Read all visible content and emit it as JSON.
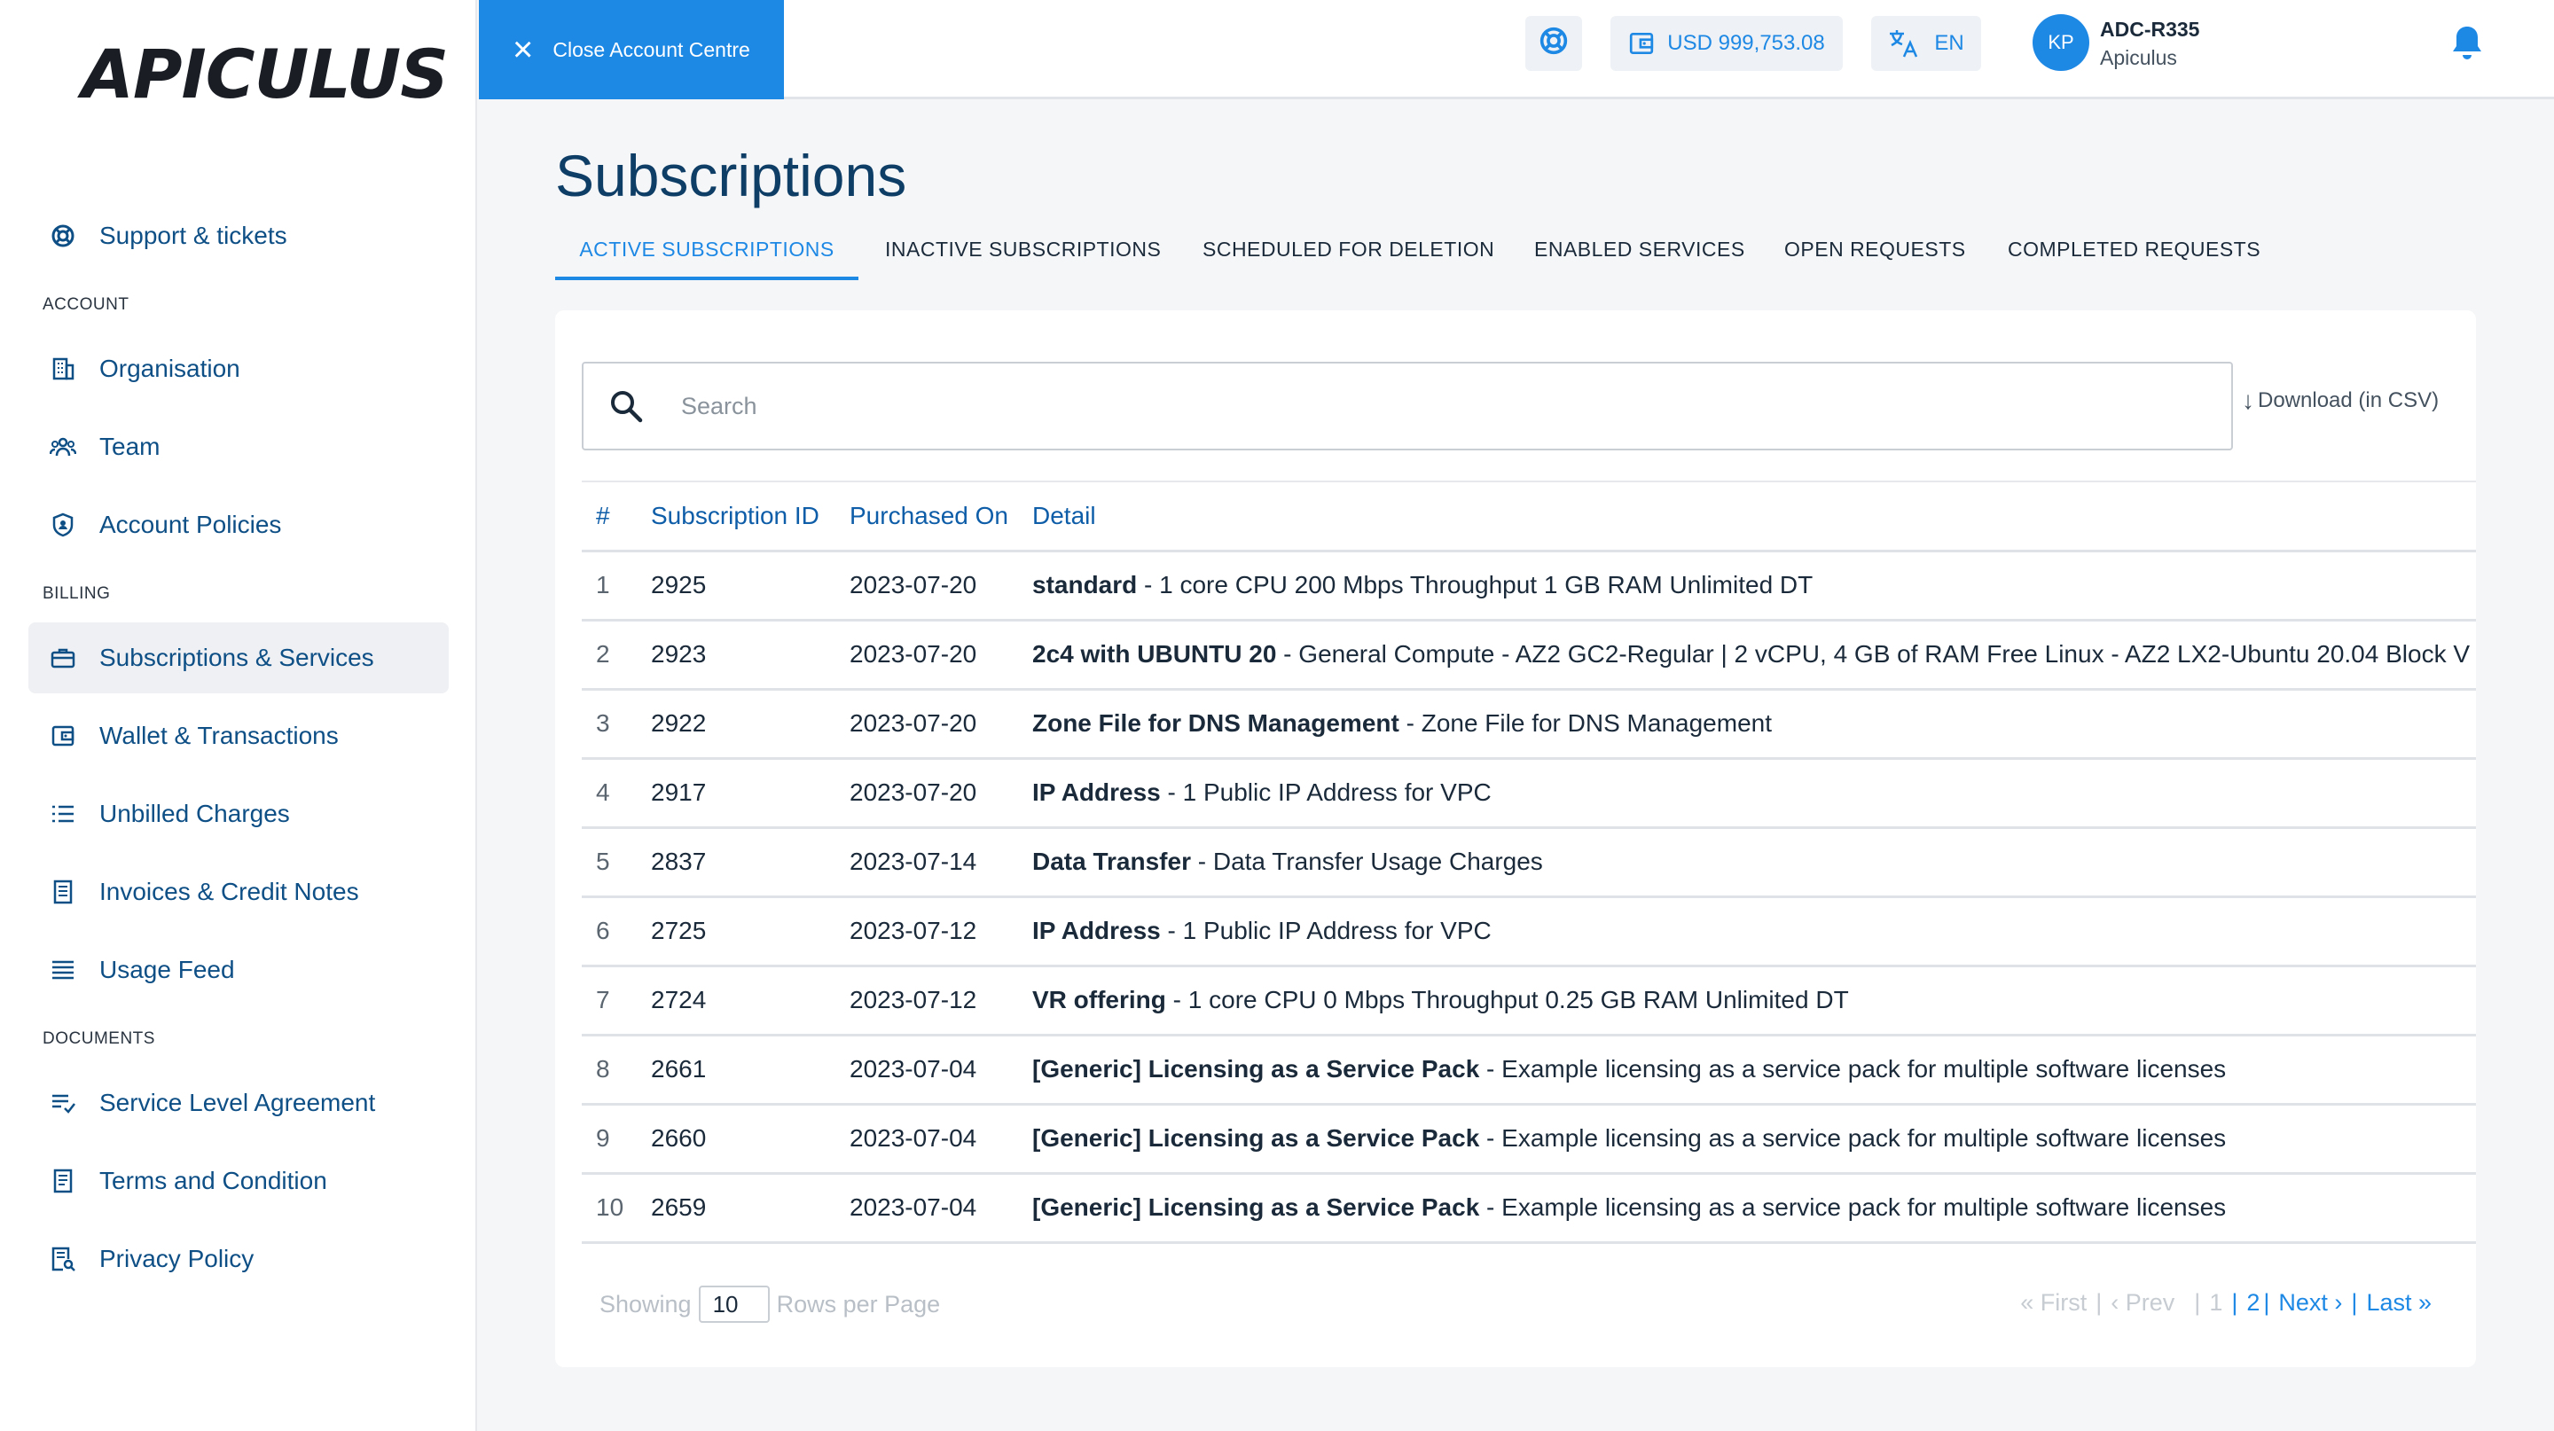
{
  "app": {
    "logo_text": "APICULUS"
  },
  "topbar": {
    "close_label": "Close Account Centre",
    "balance": "USD 999,753.08",
    "language": "EN",
    "avatar_initials": "KP",
    "user_name": "ADC-R335",
    "user_org": "Apiculus"
  },
  "sidebar": {
    "support": "Support & tickets",
    "sections": {
      "account": "ACCOUNT",
      "billing": "BILLING",
      "documents": "DOCUMENTS"
    },
    "items": [
      {
        "label": "Organisation",
        "icon": "building-icon"
      },
      {
        "label": "Team",
        "icon": "team-icon"
      },
      {
        "label": "Account Policies",
        "icon": "shield-icon"
      },
      {
        "label": "Subscriptions & Services",
        "icon": "briefcase-icon",
        "active": true
      },
      {
        "label": "Wallet & Transactions",
        "icon": "wallet-icon"
      },
      {
        "label": "Unbilled Charges",
        "icon": "list-icon"
      },
      {
        "label": "Invoices & Credit Notes",
        "icon": "invoice-icon"
      },
      {
        "label": "Usage Feed",
        "icon": "feed-icon"
      },
      {
        "label": "Service Level Agreement",
        "icon": "sla-icon"
      },
      {
        "label": "Terms and Condition",
        "icon": "document-icon"
      },
      {
        "label": "Privacy Policy",
        "icon": "privacy-icon"
      }
    ]
  },
  "main": {
    "title": "Subscriptions",
    "tabs": [
      {
        "label": "ACTIVE SUBSCRIPTIONS",
        "active": true
      },
      {
        "label": "INACTIVE SUBSCRIPTIONS"
      },
      {
        "label": "SCHEDULED FOR DELETION"
      },
      {
        "label": "ENABLED SERVICES"
      },
      {
        "label": "OPEN REQUESTS"
      },
      {
        "label": "COMPLETED REQUESTS"
      }
    ],
    "search_placeholder": "Search",
    "download_label": "Download (in CSV)",
    "table": {
      "headers": [
        "#",
        "Subscription ID",
        "Purchased On",
        "Detail"
      ],
      "rows": [
        {
          "n": "1",
          "id": "2925",
          "date": "2023-07-20",
          "name": "standard",
          "desc": " - 1 core CPU 200 Mbps Throughput 1 GB RAM Unlimited DT"
        },
        {
          "n": "2",
          "id": "2923",
          "date": "2023-07-20",
          "name": "2c4 with UBUNTU 20",
          "desc": " - General Compute - AZ2 GC2-Regular | 2 vCPU, 4 GB of RAM Free Linux - AZ2 LX2-Ubuntu 20.04 Block V"
        },
        {
          "n": "3",
          "id": "2922",
          "date": "2023-07-20",
          "name": "Zone File for DNS Management",
          "desc": " - Zone File for DNS Management"
        },
        {
          "n": "4",
          "id": "2917",
          "date": "2023-07-20",
          "name": "IP Address",
          "desc": " - 1 Public IP Address for VPC"
        },
        {
          "n": "5",
          "id": "2837",
          "date": "2023-07-14",
          "name": "Data Transfer",
          "desc": " - Data Transfer Usage Charges"
        },
        {
          "n": "6",
          "id": "2725",
          "date": "2023-07-12",
          "name": "IP Address",
          "desc": " - 1 Public IP Address for VPC"
        },
        {
          "n": "7",
          "id": "2724",
          "date": "2023-07-12",
          "name": "VR offering",
          "desc": " - 1 core CPU 0 Mbps Throughput 0.25 GB RAM Unlimited DT"
        },
        {
          "n": "8",
          "id": "2661",
          "date": "2023-07-04",
          "name": "[Generic] Licensing as a Service Pack",
          "desc": " - Example licensing as a service pack for multiple software licenses"
        },
        {
          "n": "9",
          "id": "2660",
          "date": "2023-07-04",
          "name": "[Generic] Licensing as a Service Pack",
          "desc": " - Example licensing as a service pack for multiple software licenses"
        },
        {
          "n": "10",
          "id": "2659",
          "date": "2023-07-04",
          "name": "[Generic] Licensing as a Service Pack",
          "desc": " - Example licensing as a service pack for multiple software licenses"
        }
      ]
    },
    "footer": {
      "showing": "Showing",
      "rows_value": "10",
      "rows_per_page": "Rows per Page"
    },
    "pager": {
      "first": "« First",
      "prev": "‹ Prev",
      "page1": "1",
      "page2": "2",
      "next": "Next ›",
      "last": "Last »"
    }
  },
  "colors": {
    "accent": "#1e88e5",
    "nav_text": "#0e4f86",
    "title": "#0e3d66"
  }
}
